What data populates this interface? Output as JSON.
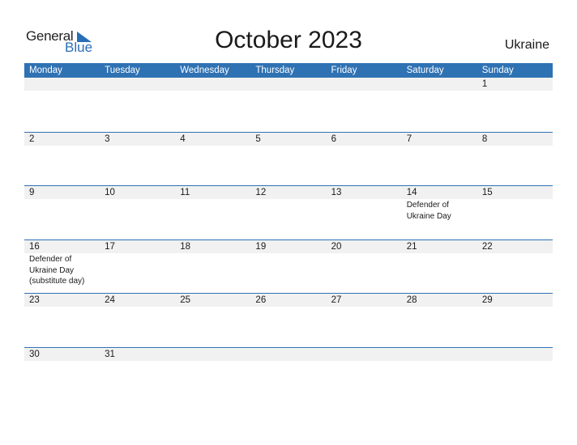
{
  "logo": {
    "word1": "General",
    "word2": "Blue"
  },
  "title": "October 2023",
  "country": "Ukraine",
  "colors": {
    "accent": "#2f72b3",
    "strip": "#f1f1f1"
  },
  "weekdays": [
    "Monday",
    "Tuesday",
    "Wednesday",
    "Thursday",
    "Friday",
    "Saturday",
    "Sunday"
  ],
  "weeks": [
    [
      {
        "d": ""
      },
      {
        "d": ""
      },
      {
        "d": ""
      },
      {
        "d": ""
      },
      {
        "d": ""
      },
      {
        "d": ""
      },
      {
        "d": "1"
      }
    ],
    [
      {
        "d": "2"
      },
      {
        "d": "3"
      },
      {
        "d": "4"
      },
      {
        "d": "5"
      },
      {
        "d": "6"
      },
      {
        "d": "7"
      },
      {
        "d": "8"
      }
    ],
    [
      {
        "d": "9"
      },
      {
        "d": "10"
      },
      {
        "d": "11"
      },
      {
        "d": "12"
      },
      {
        "d": "13"
      },
      {
        "d": "14",
        "event": "Defender of Ukraine Day"
      },
      {
        "d": "15"
      }
    ],
    [
      {
        "d": "16",
        "event": "Defender of Ukraine Day (substitute day)"
      },
      {
        "d": "17"
      },
      {
        "d": "18"
      },
      {
        "d": "19"
      },
      {
        "d": "20"
      },
      {
        "d": "21"
      },
      {
        "d": "22"
      }
    ],
    [
      {
        "d": "23"
      },
      {
        "d": "24"
      },
      {
        "d": "25"
      },
      {
        "d": "26"
      },
      {
        "d": "27"
      },
      {
        "d": "28"
      },
      {
        "d": "29"
      }
    ],
    [
      {
        "d": "30"
      },
      {
        "d": "31"
      },
      {
        "d": ""
      },
      {
        "d": ""
      },
      {
        "d": ""
      },
      {
        "d": ""
      },
      {
        "d": ""
      }
    ]
  ]
}
